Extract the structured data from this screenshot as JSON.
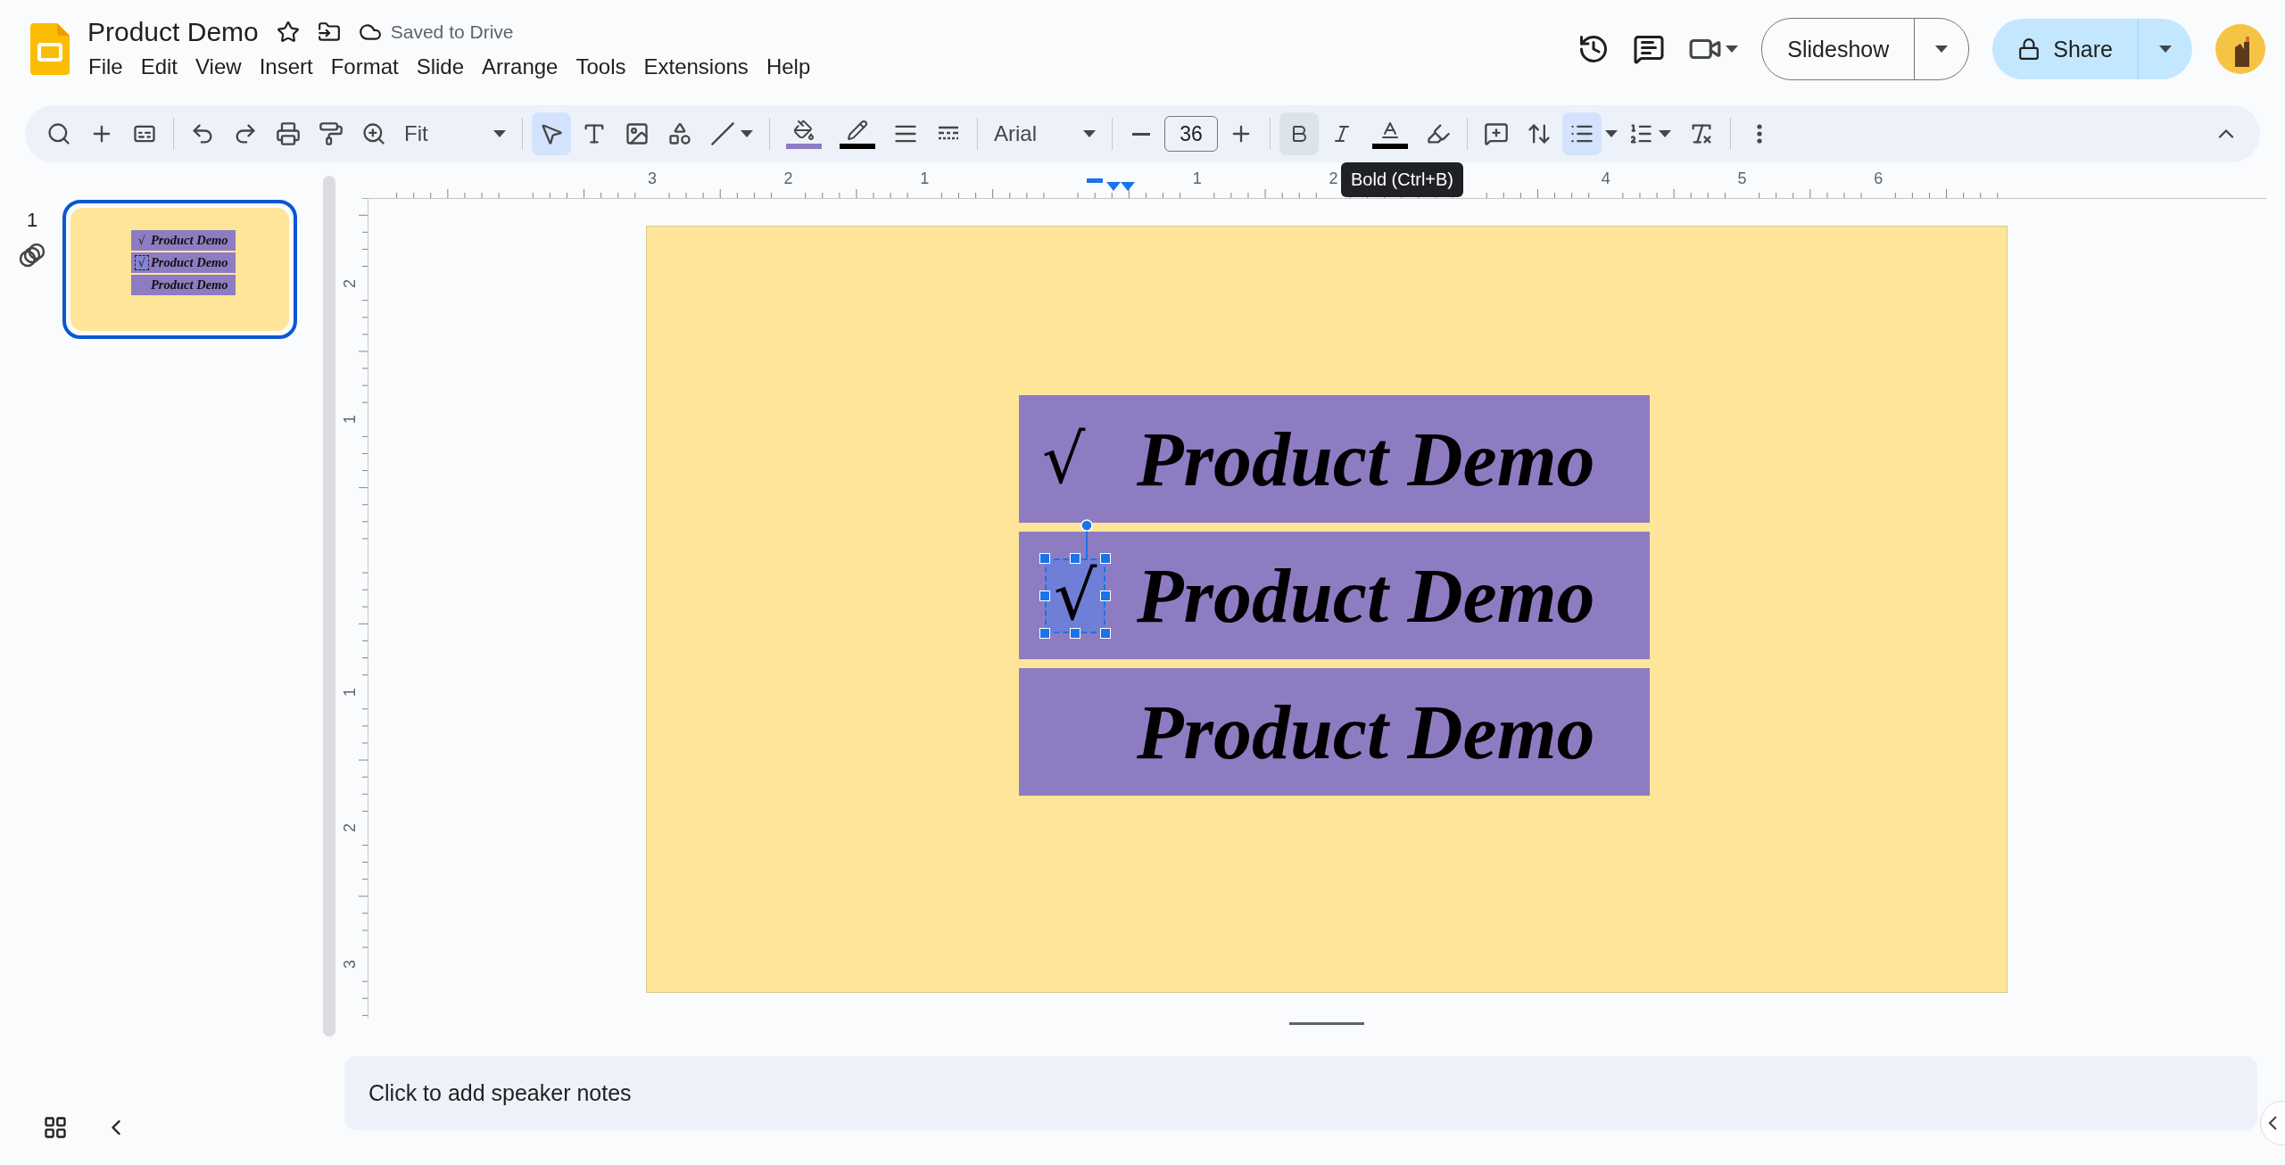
{
  "document": {
    "title": "Product Demo",
    "save_status": "Saved to Drive"
  },
  "menu": [
    "File",
    "Edit",
    "View",
    "Insert",
    "Format",
    "Slide",
    "Arrange",
    "Tools",
    "Extensions",
    "Help"
  ],
  "header_buttons": {
    "slideshow": "Slideshow",
    "share": "Share"
  },
  "toolbar": {
    "zoom": "Fit",
    "font": "Arial",
    "font_size": "36",
    "select_tool": {
      "selected": true
    },
    "bold": {
      "hovered": true
    },
    "bulleted_list": {
      "selected": true
    }
  },
  "tooltip": "Bold (Ctrl+B)",
  "ruler": {
    "horizontal": [
      "3",
      "2",
      "1",
      "1",
      "2",
      "4",
      "5",
      "6"
    ],
    "vertical": [
      "2",
      "1",
      "1",
      "2",
      "3"
    ]
  },
  "thumbnail": {
    "number": "1",
    "selected": true,
    "boxes": [
      {
        "bullet": "√",
        "text": "Product Demo",
        "bullet_selected": false
      },
      {
        "bullet": "√",
        "text": "Product Demo",
        "bullet_selected": true
      },
      {
        "text": "Product Demo"
      }
    ]
  },
  "slide": {
    "boxes": [
      {
        "bullet": "√",
        "text": "Product Demo",
        "bullet_selected": false
      },
      {
        "bullet": "√",
        "text": "Product Demo",
        "bullet_selected": true
      },
      {
        "text": "Product Demo"
      }
    ]
  },
  "speaker_notes": {
    "placeholder": "Click to add speaker notes"
  }
}
